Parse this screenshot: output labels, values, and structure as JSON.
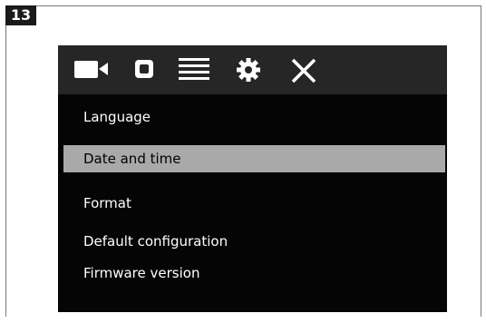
{
  "step_number": "13",
  "toolbar": {
    "icons": [
      "video-camera-icon",
      "photo-camera-icon",
      "menu-icon",
      "gear-icon",
      "close-icon"
    ]
  },
  "menu": {
    "items": [
      {
        "label": "Language",
        "selected": false
      },
      {
        "label": "Date and time",
        "selected": true
      },
      {
        "label": "Format",
        "selected": false
      },
      {
        "label": "Default configuration",
        "selected": false
      },
      {
        "label": "Firmware version",
        "selected": false
      }
    ]
  },
  "colors": {
    "screen_background": "#050505",
    "toolbar_background": "#262626",
    "selected_background": "#a9a9a9",
    "text": "#ffffff"
  }
}
